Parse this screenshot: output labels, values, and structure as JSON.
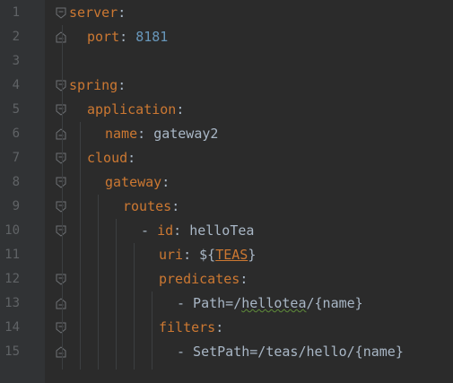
{
  "editor": {
    "lines": [
      {
        "num": "1",
        "fold": "open",
        "indent": 0,
        "segments": [
          {
            "t": "server",
            "c": "k"
          },
          {
            "t": ":",
            "c": "p"
          }
        ]
      },
      {
        "num": "2",
        "fold": "close",
        "indent": 1,
        "segments": [
          {
            "t": "port",
            "c": "k"
          },
          {
            "t": ": ",
            "c": "p"
          },
          {
            "t": "8181",
            "c": "n"
          }
        ]
      },
      {
        "num": "3",
        "fold": "",
        "indent": 0,
        "segments": []
      },
      {
        "num": "4",
        "fold": "open",
        "indent": 0,
        "segments": [
          {
            "t": "spring",
            "c": "k"
          },
          {
            "t": ":",
            "c": "p"
          }
        ]
      },
      {
        "num": "5",
        "fold": "open",
        "indent": 1,
        "segments": [
          {
            "t": "application",
            "c": "k"
          },
          {
            "t": ":",
            "c": "p"
          }
        ]
      },
      {
        "num": "6",
        "fold": "close",
        "indent": 2,
        "segments": [
          {
            "t": "name",
            "c": "k"
          },
          {
            "t": ": ",
            "c": "p"
          },
          {
            "t": "gateway2",
            "c": "v"
          }
        ]
      },
      {
        "num": "7",
        "fold": "open",
        "indent": 1,
        "segments": [
          {
            "t": "cloud",
            "c": "k"
          },
          {
            "t": ":",
            "c": "p"
          }
        ]
      },
      {
        "num": "8",
        "fold": "open",
        "indent": 2,
        "segments": [
          {
            "t": "gateway",
            "c": "k"
          },
          {
            "t": ":",
            "c": "p"
          }
        ]
      },
      {
        "num": "9",
        "fold": "open",
        "indent": 3,
        "segments": [
          {
            "t": "routes",
            "c": "k"
          },
          {
            "t": ":",
            "c": "p"
          }
        ]
      },
      {
        "num": "10",
        "fold": "open",
        "indent": 4,
        "segments": [
          {
            "t": "- ",
            "c": "p"
          },
          {
            "t": "id",
            "c": "k"
          },
          {
            "t": ": ",
            "c": "p"
          },
          {
            "t": "helloTea",
            "c": "v"
          }
        ]
      },
      {
        "num": "11",
        "fold": "",
        "indent": 5,
        "segments": [
          {
            "t": "uri",
            "c": "k"
          },
          {
            "t": ": ",
            "c": "p"
          },
          {
            "t": "${",
            "c": "v"
          },
          {
            "t": "TEAS",
            "c": "teas"
          },
          {
            "t": "}",
            "c": "v"
          }
        ]
      },
      {
        "num": "12",
        "fold": "open",
        "indent": 5,
        "segments": [
          {
            "t": "predicates",
            "c": "k"
          },
          {
            "t": ":",
            "c": "p"
          }
        ]
      },
      {
        "num": "13",
        "fold": "close",
        "indent": 6,
        "segments": [
          {
            "t": "- Path=/",
            "c": "v"
          },
          {
            "t": "hellotea",
            "c": "squig"
          },
          {
            "t": "/{name}",
            "c": "v"
          }
        ]
      },
      {
        "num": "14",
        "fold": "open",
        "indent": 5,
        "segments": [
          {
            "t": "filters",
            "c": "k"
          },
          {
            "t": ":",
            "c": "p"
          }
        ]
      },
      {
        "num": "15",
        "fold": "close",
        "indent": 6,
        "segments": [
          {
            "t": "- SetPath=/teas/hello/{name}",
            "c": "v"
          }
        ]
      }
    ]
  },
  "colors": {
    "background": "#2b2b2b",
    "gutter": "#313335",
    "keyword": "#cc7832",
    "value": "#a9b7c6",
    "number": "#6897bb",
    "line_number": "#606366"
  },
  "icons": {
    "fold_open": "fold-expanded-icon",
    "fold_close": "fold-end-icon"
  }
}
